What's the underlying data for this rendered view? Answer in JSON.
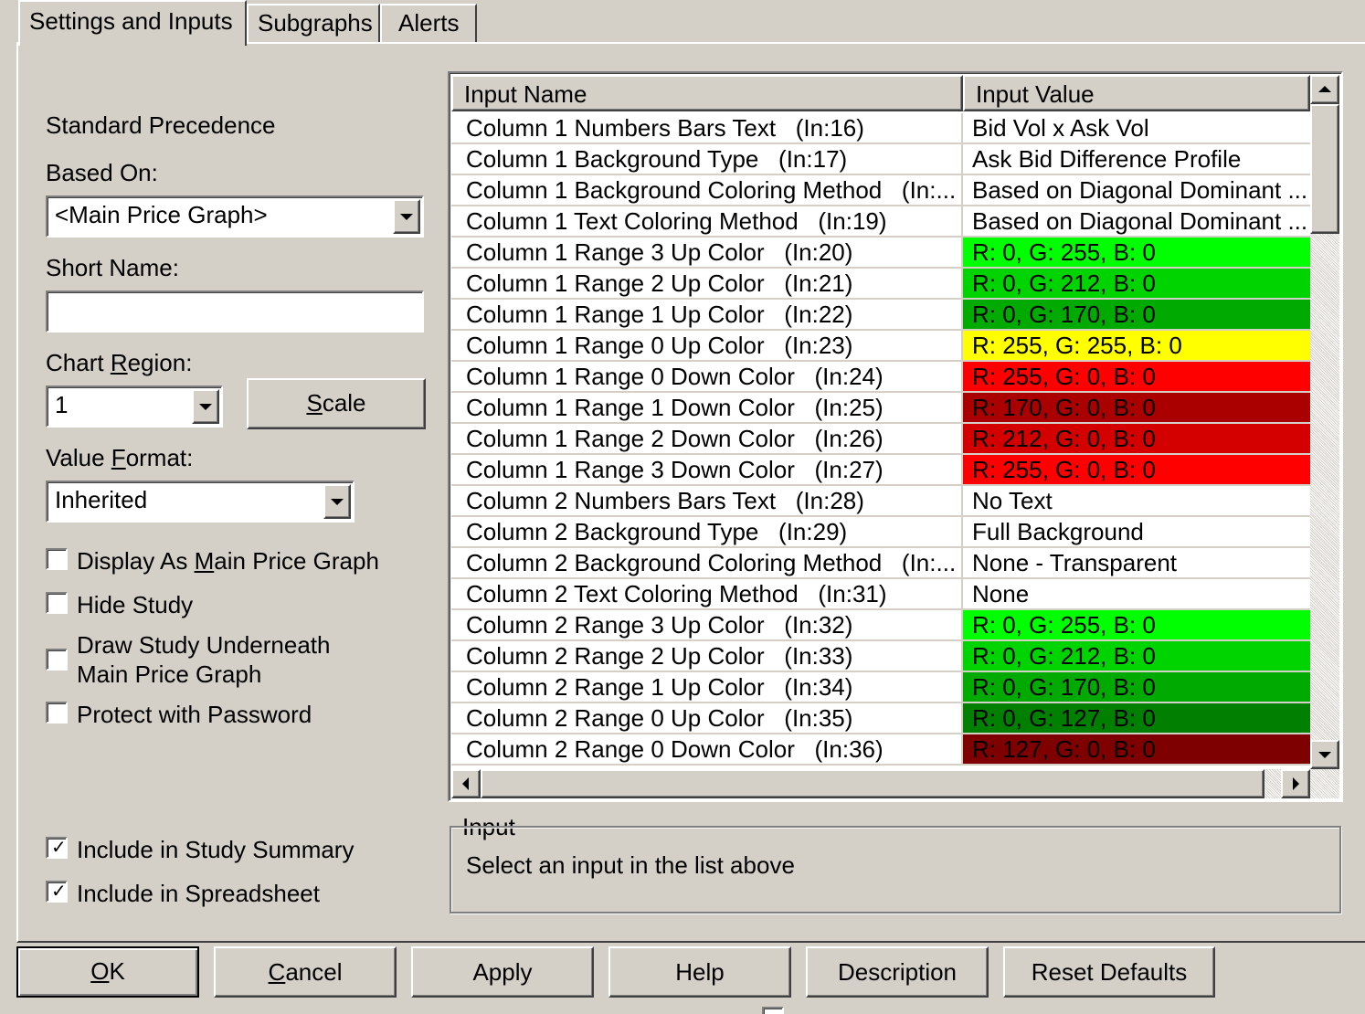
{
  "tabs": [
    {
      "label": "Settings and Inputs",
      "active": true
    },
    {
      "label": "Subgraphs",
      "active": false
    },
    {
      "label": "Alerts",
      "active": false
    }
  ],
  "left_panel": {
    "standard_precedence": "Standard Precedence",
    "based_on_label": "Based On:",
    "based_on_value": "<Main Price Graph>",
    "short_name_label": "Short Name:",
    "short_name_value": "",
    "chart_region_label_pre": "Chart ",
    "chart_region_label_u": "R",
    "chart_region_label_post": "egion:",
    "chart_region_value": "1",
    "scale_button_u": "S",
    "scale_button_rest": "cale",
    "value_format_label_pre": "Value ",
    "value_format_label_u": "F",
    "value_format_label_post": "ormat:",
    "value_format_value": "Inherited",
    "checkboxes": [
      {
        "pre": "Display As ",
        "u": "M",
        "post": "ain Price Graph",
        "checked": false
      },
      {
        "pre": "Hide Study",
        "u": "",
        "post": "",
        "checked": false
      },
      {
        "pre": "Draw Study Underneath",
        "u": "",
        "post": "",
        "line2": "Main Price Graph",
        "checked": false
      },
      {
        "pre": "Protect with Password",
        "u": "",
        "post": "",
        "checked": false
      },
      {
        "pre": "Include in Study Summary",
        "u": "",
        "post": "",
        "checked": true
      },
      {
        "pre": "Include in Spreadsheet",
        "u": "",
        "post": "",
        "checked": true
      }
    ],
    "check_mark": "✓"
  },
  "grid": {
    "header_name": "Input Name",
    "header_value": "Input Value",
    "rows": [
      {
        "name": "Column 1 Numbers Bars Text   (In:16)",
        "value": "Bid Vol x Ask Vol",
        "bg": "#ffffff"
      },
      {
        "name": "Column 1 Background Type   (In:17)",
        "value": "Ask Bid Difference Profile",
        "bg": "#ffffff"
      },
      {
        "name": "Column 1 Background Coloring Method   (In:...",
        "value": "Based on Diagonal Dominant ...",
        "bg": "#ffffff"
      },
      {
        "name": "Column 1 Text Coloring Method   (In:19)",
        "value": "Based on Diagonal Dominant ...",
        "bg": "#ffffff"
      },
      {
        "name": "Column 1 Range 3 Up Color   (In:20)",
        "value": "R: 0, G: 255, B: 0",
        "bg": "#00ff00"
      },
      {
        "name": "Column 1 Range 2 Up Color   (In:21)",
        "value": "R: 0, G: 212, B: 0",
        "bg": "#00d400"
      },
      {
        "name": "Column 1 Range 1 Up Color   (In:22)",
        "value": "R: 0, G: 170, B: 0",
        "bg": "#00aa00"
      },
      {
        "name": "Column 1 Range 0 Up Color   (In:23)",
        "value": "R: 255, G: 255, B: 0",
        "bg": "#ffff00"
      },
      {
        "name": "Column 1 Range 0 Down Color   (In:24)",
        "value": "R: 255, G: 0, B: 0",
        "bg": "#ff0000"
      },
      {
        "name": "Column 1 Range 1 Down Color   (In:25)",
        "value": "R: 170, G: 0, B: 0",
        "bg": "#aa0000"
      },
      {
        "name": "Column 1 Range 2 Down Color   (In:26)",
        "value": "R: 212, G: 0, B: 0",
        "bg": "#d40000"
      },
      {
        "name": "Column 1 Range 3 Down Color   (In:27)",
        "value": "R: 255, G: 0, B: 0",
        "bg": "#ff0000"
      },
      {
        "name": "Column 2 Numbers Bars Text   (In:28)",
        "value": "No Text",
        "bg": "#ffffff"
      },
      {
        "name": "Column 2 Background Type   (In:29)",
        "value": "Full Background",
        "bg": "#ffffff"
      },
      {
        "name": "Column 2 Background Coloring Method   (In:...",
        "value": "None - Transparent",
        "bg": "#ffffff"
      },
      {
        "name": "Column 2 Text Coloring Method   (In:31)",
        "value": "None",
        "bg": "#ffffff"
      },
      {
        "name": "Column 2 Range 3 Up Color   (In:32)",
        "value": "R: 0, G: 255, B: 0",
        "bg": "#00ff00"
      },
      {
        "name": "Column 2 Range 2 Up Color   (In:33)",
        "value": "R: 0, G: 212, B: 0",
        "bg": "#00d400"
      },
      {
        "name": "Column 2 Range 1 Up Color   (In:34)",
        "value": "R: 0, G: 170, B: 0",
        "bg": "#00aa00"
      },
      {
        "name": "Column 2 Range 0 Up Color   (In:35)",
        "value": "R: 0, G: 127, B: 0",
        "bg": "#007f00"
      },
      {
        "name": "Column 2 Range 0 Down Color   (In:36)",
        "value": "R: 127, G: 0, B: 0",
        "bg": "#7f0000"
      }
    ]
  },
  "input_group": {
    "title": "Input",
    "message": "Select an input in the list above"
  },
  "buttons": [
    {
      "pre": "",
      "u": "O",
      "post": "K",
      "default": true
    },
    {
      "pre": "",
      "u": "C",
      "post": "ancel",
      "default": false
    },
    {
      "pre": "Apply",
      "u": "",
      "post": "",
      "default": false
    },
    {
      "pre": "Help",
      "u": "",
      "post": "",
      "default": false
    },
    {
      "pre": "Description",
      "u": "",
      "post": "",
      "default": false
    },
    {
      "pre": "Reset Defaults",
      "u": "",
      "post": "",
      "default": false
    }
  ]
}
